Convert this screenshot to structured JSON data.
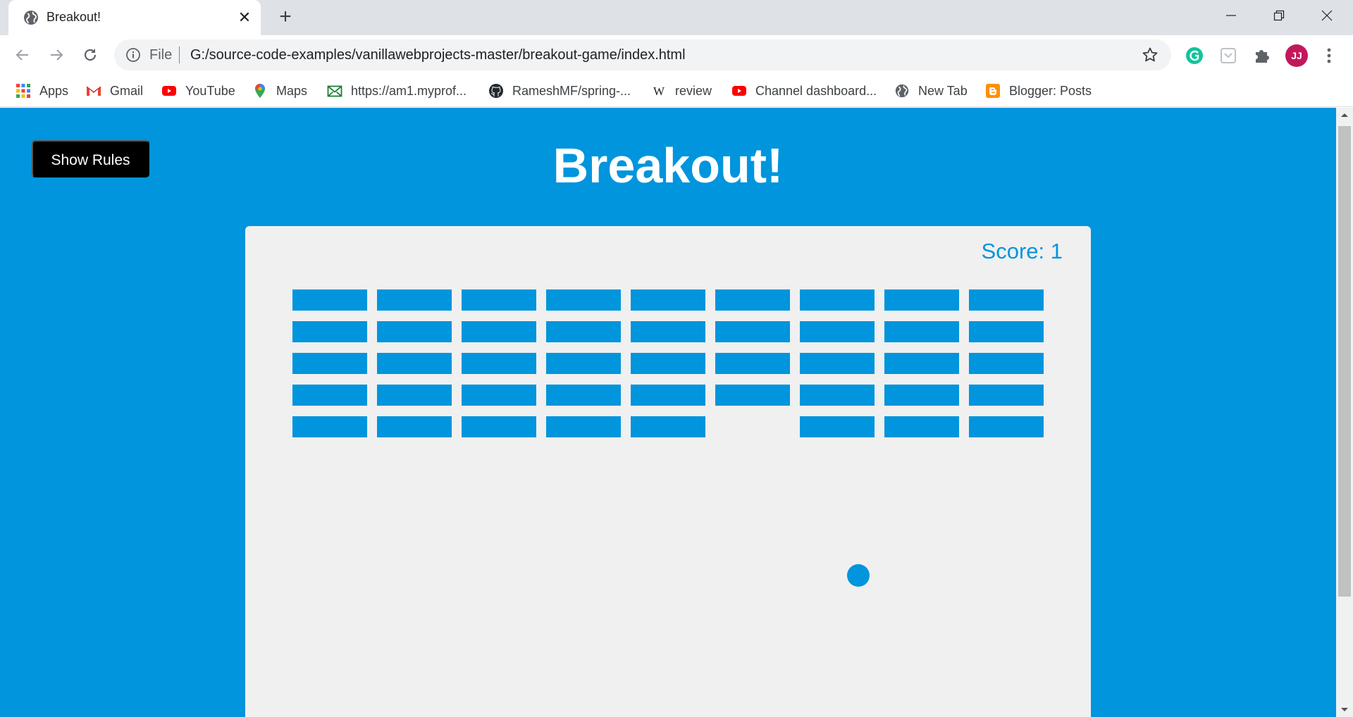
{
  "tab": {
    "title": "Breakout!"
  },
  "address_bar": {
    "scheme_label": "File",
    "url": "G:/source-code-examples/vanillawebprojects-master/breakout-game/index.html"
  },
  "profile": {
    "avatar_text": "JJ"
  },
  "bookmarks": [
    {
      "label": "Apps",
      "icon": "apps-grid-icon"
    },
    {
      "label": "Gmail",
      "icon": "gmail-icon"
    },
    {
      "label": "YouTube",
      "icon": "youtube-icon"
    },
    {
      "label": "Maps",
      "icon": "maps-pin-icon"
    },
    {
      "label": "https://am1.myprof...",
      "icon": "mail-icon"
    },
    {
      "label": "RameshMF/spring-...",
      "icon": "github-icon"
    },
    {
      "label": "review",
      "icon": "wikipedia-icon"
    },
    {
      "label": "Channel dashboard...",
      "icon": "youtube-icon"
    },
    {
      "label": "New Tab",
      "icon": "globe-icon"
    },
    {
      "label": "Blogger: Posts",
      "icon": "blogger-icon"
    }
  ],
  "page": {
    "rules_button": "Show Rules",
    "title": "Breakout!",
    "score_text": "Score: 1"
  },
  "game": {
    "columns": 9,
    "rows": 5,
    "destroyed_bricks": [
      {
        "row": 4,
        "col": 5
      }
    ]
  },
  "colors": {
    "page_background": "#0095dd",
    "brick": "#0095dd",
    "canvas": "#f0f0f0",
    "button": "#000000"
  }
}
